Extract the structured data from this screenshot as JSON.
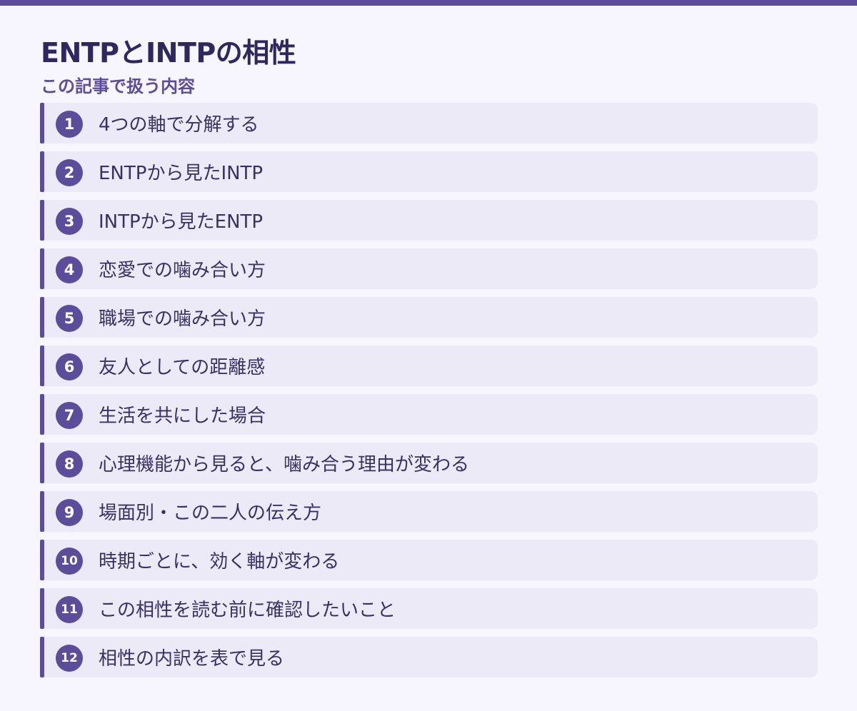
{
  "page": {
    "title": "ENTPとINTPの相性",
    "section_label": "この記事で扱う内容"
  },
  "colors": {
    "accent": "#5c4d9c",
    "title": "#2f2760",
    "item_bg": "#edeaf7",
    "page_bg": "#f7f5fd"
  },
  "toc": {
    "items": [
      {
        "number": "1",
        "label": "4つの軸で分解する"
      },
      {
        "number": "2",
        "label": "ENTPから見たINTP"
      },
      {
        "number": "3",
        "label": "INTPから見たENTP"
      },
      {
        "number": "4",
        "label": "恋愛での噛み合い方"
      },
      {
        "number": "5",
        "label": "職場での噛み合い方"
      },
      {
        "number": "6",
        "label": "友人としての距離感"
      },
      {
        "number": "7",
        "label": "生活を共にした場合"
      },
      {
        "number": "8",
        "label": "心理機能から見ると、噛み合う理由が変わる"
      },
      {
        "number": "9",
        "label": "場面別・この二人の伝え方"
      },
      {
        "number": "10",
        "label": "時期ごとに、効く軸が変わる"
      },
      {
        "number": "11",
        "label": "この相性を読む前に確認したいこと"
      },
      {
        "number": "12",
        "label": "相性の内訳を表で見る"
      }
    ]
  }
}
